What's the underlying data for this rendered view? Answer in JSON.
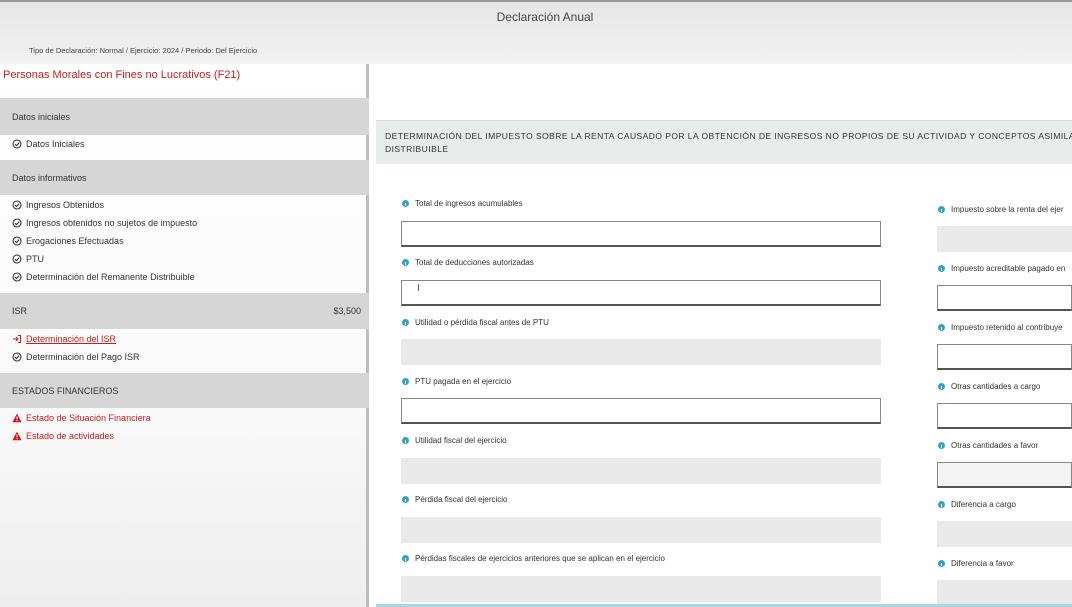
{
  "header": {
    "title": "Declaración Anual",
    "subtitle": "Tipo de Declaración: Normal / Ejercicio: 2024 / Periodo: Del Ejercicio"
  },
  "sidebar": {
    "heading": "Personas Morales con Fines no Lucrativos (F21)",
    "sections": [
      {
        "label": "Datos iniciales",
        "amount": ""
      },
      {
        "label": "Datos informativos",
        "amount": ""
      },
      {
        "label": "ISR",
        "amount": "$3,500"
      },
      {
        "label": "ESTADOS FINANCIEROS",
        "amount": ""
      }
    ],
    "items": {
      "datos_iniciales": "Datos Iniciales",
      "ingresos_obtenidos": "Ingresos Obtenidos",
      "ingresos_no_sujetos": "Ingresos obtenidos no sujetos de impuesto",
      "erogaciones": "Erogaciones Efectuadas",
      "ptu": "PTU",
      "remanente": "Determinación del Remanente Distribuible",
      "det_isr": "Determinación del ISR",
      "det_pago_isr": "Determinación del Pago ISR",
      "situacion_financiera": "Estado de Situación Financiera",
      "estado_actividades": "Estado de actividades"
    }
  },
  "main": {
    "panel_title": "DETERMINACIÓN DEL IMPUESTO SOBRE LA RENTA CAUSADO POR LA OBTENCIÓN DE INGRESOS NO PROPIOS DE SU ACTIVIDAD Y CONCEPTOS ASIMILA DISTRIBUIBLE",
    "left_fields": [
      {
        "label": "Total de ingresos acumulables",
        "editable": true,
        "value": ""
      },
      {
        "label": "Total de deducciones autorizadas",
        "editable": true,
        "value": ""
      },
      {
        "label": "Utilidad o pérdida fiscal antes de PTU",
        "editable": false,
        "value": ""
      },
      {
        "label": "PTU pagada en el ejercicio",
        "editable": true,
        "value": ""
      },
      {
        "label": "Utilidad fiscal del ejercicio",
        "editable": false,
        "value": ""
      },
      {
        "label": "Pérdida fiscal del ejercicio",
        "editable": false,
        "value": ""
      },
      {
        "label": "Pérdidas fiscales de ejercicios anteriores que se aplican en el ejercicio",
        "editable": false,
        "value": ""
      }
    ],
    "right_fields": [
      {
        "label": "Impuesto sobre la renta del ejer",
        "editable": false,
        "value": ""
      },
      {
        "label": "Impuesto acreditable pagado en",
        "editable": true,
        "value": ""
      },
      {
        "label": "Impuesto retenido al contribuye",
        "editable": true,
        "value": ""
      },
      {
        "label": "Otras cantidades a cargo",
        "editable": true,
        "value": ""
      },
      {
        "label": "Otras cantidades a favor",
        "editable": true,
        "value": ""
      },
      {
        "label": "Diferencia a cargo",
        "editable": false,
        "value": ""
      },
      {
        "label": "Diferencia a favor",
        "editable": false,
        "value": ""
      }
    ]
  },
  "colors": {
    "accent_red": "#d0191a",
    "info_blue": "#33a3c4",
    "section_gray": "#d6d6d6"
  },
  "icons": {
    "check": "check-circle-icon",
    "arrow": "sign-in-arrow-icon",
    "warning": "warning-triangle-icon",
    "info": "info-icon"
  }
}
